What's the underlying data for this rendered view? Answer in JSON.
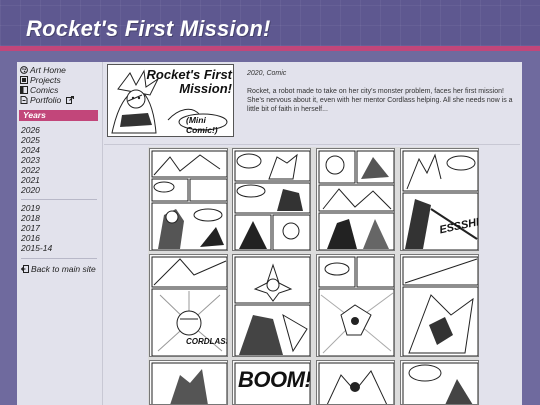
{
  "header": {
    "title": "Rocket's First Mission!"
  },
  "nav": {
    "items": [
      {
        "label": "Art Home",
        "icon": "palette-icon"
      },
      {
        "label": "Projects",
        "icon": "folder-icon"
      },
      {
        "label": "Comics",
        "icon": "book-icon"
      },
      {
        "label": "Portfolio",
        "icon": "document-icon"
      }
    ]
  },
  "years": {
    "heading": "Years",
    "recent": [
      "2026",
      "2025",
      "2024",
      "2023",
      "2022",
      "2021",
      "2020"
    ],
    "older": [
      "2019",
      "2018",
      "2017",
      "2016",
      "2015-14"
    ]
  },
  "back_link": "Back to main site",
  "comic": {
    "thumb_title_line1": "Rocket's First",
    "thumb_title_line2": "Mission!",
    "thumb_subtitle": "(Mini Comic!)",
    "meta": "2020, Comic",
    "description": "Rocket, a robot made to take on her city's monster problem, faces her first mission! She's nervous about it, even with her mentor Cordlass helping. All she needs now is a little bit of faith in herself..."
  },
  "page_text": {
    "cordlass": "CORDLASS!",
    "sfx": "ESSSHHH",
    "boom": "BOOM!"
  },
  "colors": {
    "accent": "#c2467a",
    "header_bg": "#5e5890",
    "background": "#6f6a9e",
    "panel_bg": "#e2e2ec"
  }
}
